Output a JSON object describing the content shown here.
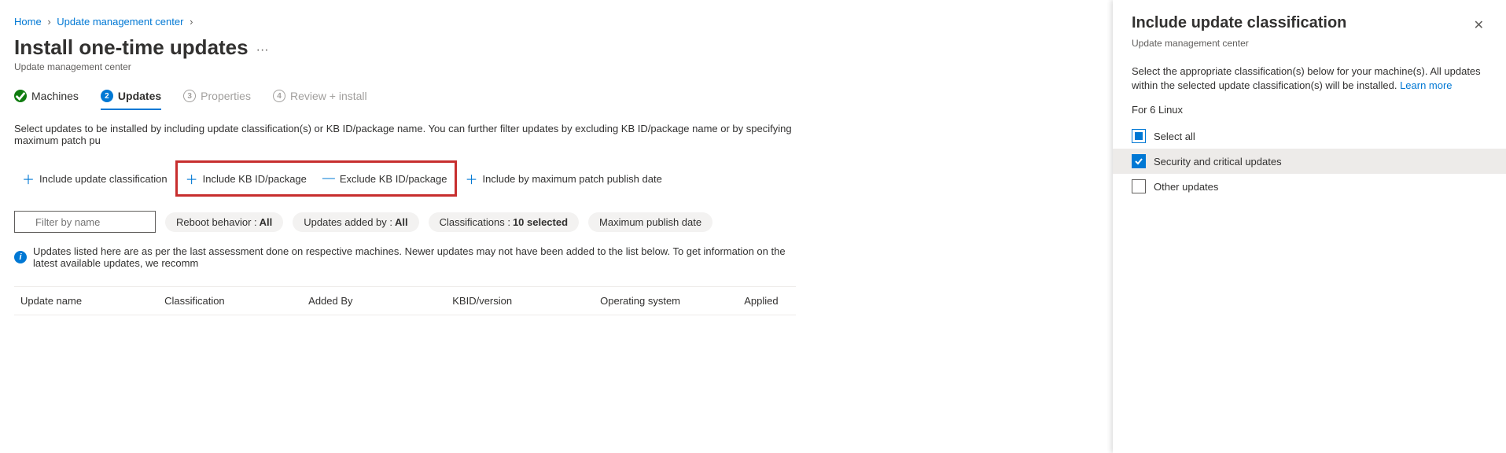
{
  "breadcrumb": {
    "home": "Home",
    "parent": "Update management center"
  },
  "header": {
    "title": "Install one-time updates",
    "subtitle": "Update management center"
  },
  "tabs": {
    "t1": "Machines",
    "t2": "Updates",
    "t3": "Properties",
    "t3_num": "3",
    "t4": "Review + install",
    "t4_num": "4"
  },
  "description": "Select updates to be installed by including update classification(s) or KB ID/package name. You can further filter updates by excluding KB ID/package name or by specifying maximum patch pu",
  "actions": {
    "include_classification": "Include update classification",
    "include_kb": "Include KB ID/package",
    "exclude_kb": "Exclude KB ID/package",
    "include_maxdate": "Include by maximum patch publish date"
  },
  "filters": {
    "placeholder": "Filter by name",
    "reboot_label": "Reboot behavior :",
    "reboot_value": "All",
    "added_label": "Updates added by :",
    "added_value": "All",
    "class_label": "Classifications :",
    "class_value": "10 selected",
    "maxdate": "Maximum publish date"
  },
  "info_text": "Updates listed here are as per the last assessment done on respective machines. Newer updates may not have been added to the list below. To get information on the latest available updates, we recomm",
  "table": {
    "c1": "Update name",
    "c2": "Classification",
    "c3": "Added By",
    "c4": "KBID/version",
    "c5": "Operating system",
    "c6": "Applied"
  },
  "panel": {
    "title": "Include update classification",
    "subtitle": "Update management center",
    "desc": "Select the appropriate classification(s) below for your machine(s). All updates within the selected update classification(s) will be installed. ",
    "learn": "Learn more",
    "for_label": "For 6 Linux",
    "select_all": "Select all",
    "opt1": "Security and critical updates",
    "opt2": "Other updates"
  }
}
